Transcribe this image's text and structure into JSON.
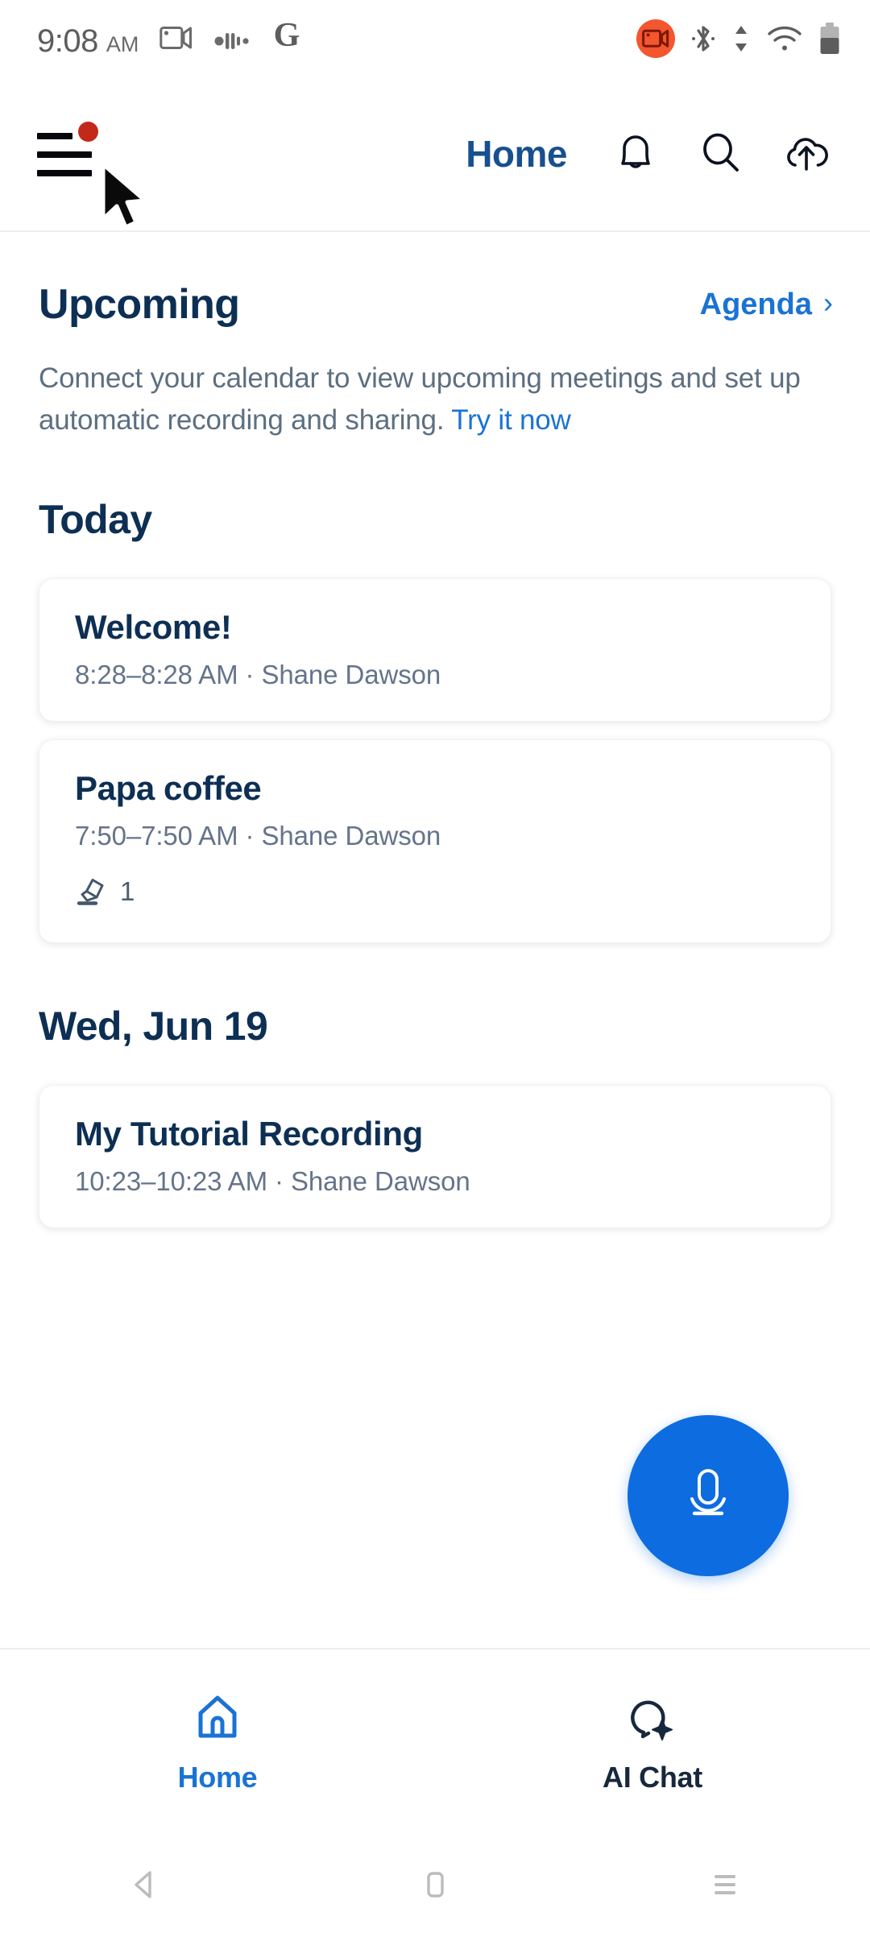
{
  "statusbar": {
    "time": "9:08",
    "ampm": "AM",
    "icons": [
      "screen-record-icon",
      "audio-wave-icon",
      "google-g-icon"
    ],
    "right_icons": [
      "recording-badge-icon",
      "bluetooth-icon",
      "data-transfer-icon",
      "wifi-icon",
      "battery-icon"
    ],
    "recording_color": "#f4562f"
  },
  "appbar": {
    "menu_icon": "hamburger-menu-icon",
    "badge_color": "#c2291b",
    "title": "Home",
    "actions": [
      {
        "name": "notifications-icon",
        "label": "Notifications"
      },
      {
        "name": "search-icon",
        "label": "Search"
      },
      {
        "name": "cloud-upload-icon",
        "label": "Upload"
      }
    ]
  },
  "upcoming": {
    "title": "Upcoming",
    "agenda_label": "Agenda",
    "agenda_chevron": "›",
    "blurb_text": "Connect your calendar to view upcoming meetings and set up automatic recording and sharing. ",
    "blurb_cta": "Try it now"
  },
  "groups": [
    {
      "heading": "Today",
      "items": [
        {
          "title": "Welcome!",
          "subtitle": "8:28–8:28 AM ·  Shane Dawson",
          "meta": null
        },
        {
          "title": "Papa coffee",
          "subtitle": "7:50–7:50 AM ·  Shane Dawson",
          "meta": {
            "icon": "highlight-pen-icon",
            "count": "1"
          }
        }
      ]
    },
    {
      "heading": "Wed, Jun 19",
      "items": [
        {
          "title": "My Tutorial Recording",
          "subtitle": "10:23–10:23 AM ·  Shane Dawson",
          "meta": null
        }
      ]
    }
  ],
  "fab": {
    "icon": "microphone-icon",
    "color": "#0d6ce0"
  },
  "bottomnav": {
    "items": [
      {
        "label": "Home",
        "icon": "home-icon",
        "active": true
      },
      {
        "label": "AI Chat",
        "icon": "ai-chat-icon",
        "active": false
      }
    ],
    "active_color": "#1a73d4",
    "inactive_color": "#16283d"
  },
  "sysnav": {
    "buttons": [
      {
        "name": "back-nav-icon"
      },
      {
        "name": "home-nav-icon"
      },
      {
        "name": "recents-nav-icon"
      }
    ]
  },
  "cursor": {
    "name": "mouse-pointer"
  }
}
